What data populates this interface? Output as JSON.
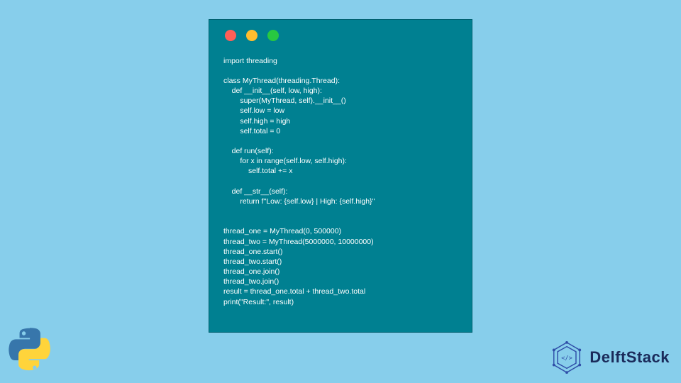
{
  "window": {
    "dots": {
      "red": "#ff5f57",
      "amber": "#ffbd2e",
      "green": "#28c840"
    }
  },
  "code": {
    "content": "import threading\n\nclass MyThread(threading.Thread):\n    def __init__(self, low, high):\n        super(MyThread, self).__init__()\n        self.low = low\n        self.high = high\n        self.total = 0\n\n    def run(self):\n        for x in range(self.low, self.high):\n            self.total += x\n\n    def __str__(self):\n        return f\"Low: {self.low} | High: {self.high}\"\n\n\nthread_one = MyThread(0, 500000)\nthread_two = MyThread(5000000, 10000000)\nthread_one.start()\nthread_two.start()\nthread_one.join()\nthread_two.join()\nresult = thread_one.total + thread_two.total\nprint(\"Result:\", result)"
  },
  "branding": {
    "delft_label": "DelftStack"
  },
  "colors": {
    "page_bg": "#87ceeb",
    "window_bg": "#008091",
    "code_fg": "#ffffff",
    "delft_text": "#1a2a5a",
    "delft_mark": "#2f4ea8",
    "python_blue": "#3776AB",
    "python_yellow": "#FFD43B"
  }
}
